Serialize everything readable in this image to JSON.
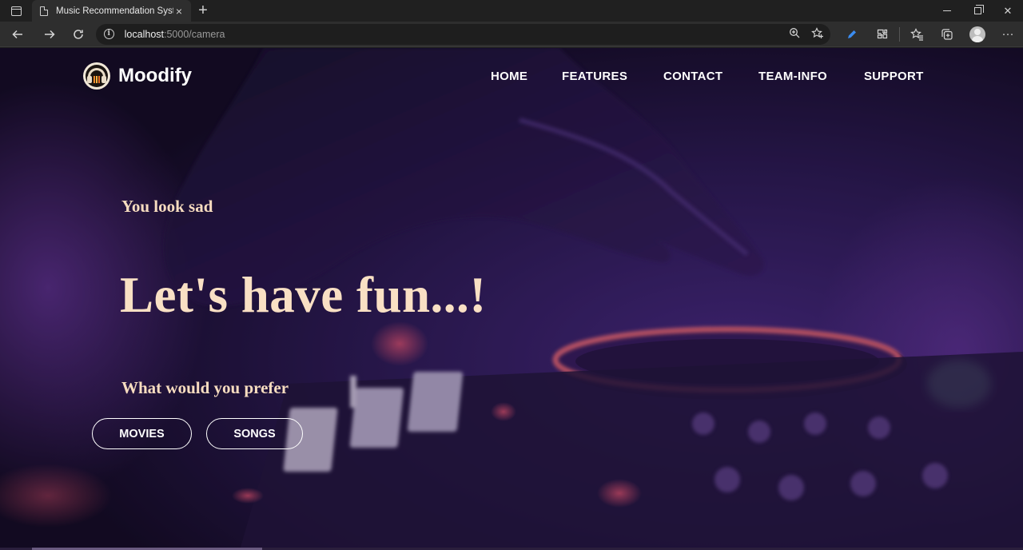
{
  "browser": {
    "tab_title": "Music Recommendation System",
    "tab_close": "×",
    "new_tab": "+",
    "url_host": "localhost",
    "url_path": ":5000/camera",
    "more": "···"
  },
  "site": {
    "brand": "Moodify",
    "nav": [
      {
        "label": "HOME"
      },
      {
        "label": "FEATURES"
      },
      {
        "label": "CONTACT"
      },
      {
        "label": "TEAM-INFO"
      },
      {
        "label": "SUPPORT"
      }
    ]
  },
  "hero": {
    "mood": "You look sad",
    "headline": "Let's have fun...!",
    "prompt": "What would you prefer",
    "buttons": {
      "movies": "MOVIES",
      "songs": "SONGS"
    }
  },
  "colors": {
    "accent_text": "#f9e0c4",
    "background": "#2b1848"
  }
}
